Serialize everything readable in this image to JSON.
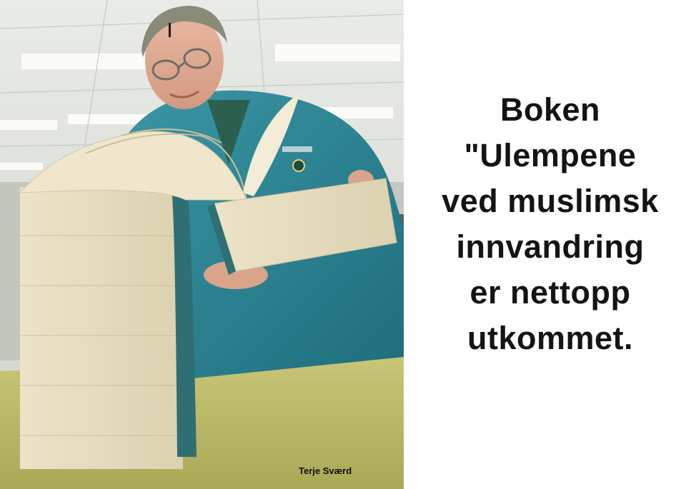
{
  "caption": {
    "lines": [
      "Boken",
      "\"Ulempene",
      "ved muslimsk",
      "innvandring",
      "er nettopp",
      "utkommet."
    ]
  },
  "photo": {
    "credit": "Terje Sværd"
  }
}
